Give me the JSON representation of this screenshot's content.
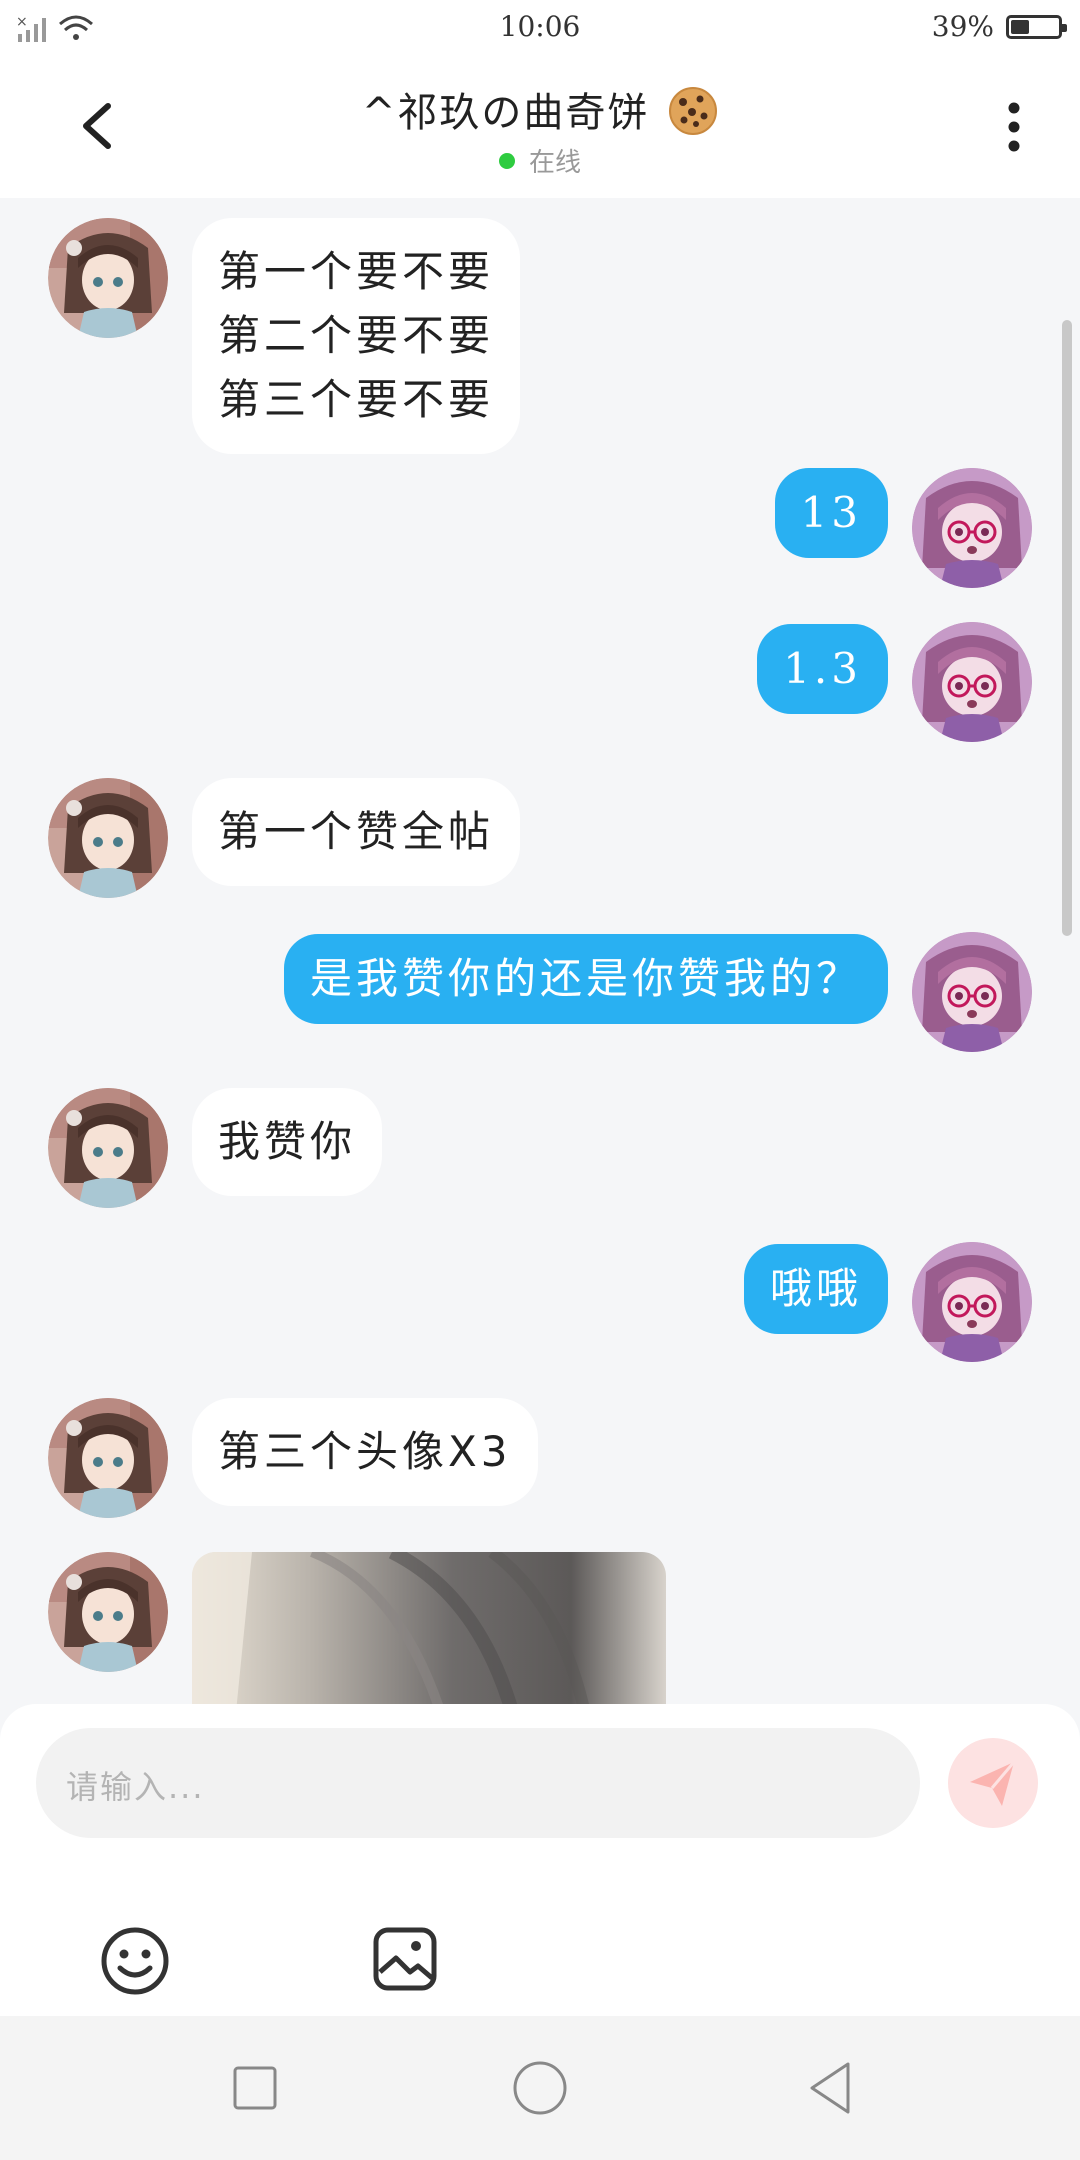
{
  "status_bar": {
    "time": "10:06",
    "battery_text": "39%",
    "battery_level": 0.39
  },
  "header": {
    "title": "^祁玖の曲奇饼",
    "status": "在线"
  },
  "messages": [
    {
      "side": "in",
      "lines": [
        "第一个要不要",
        "第二个要不要",
        "第三个要不要"
      ]
    },
    {
      "side": "out",
      "text": "13"
    },
    {
      "side": "out",
      "text": "1.3"
    },
    {
      "side": "in",
      "text": "第一个赞全帖"
    },
    {
      "side": "out",
      "text": "是我赞你的还是你赞我的？"
    },
    {
      "side": "in",
      "text": "我赞你"
    },
    {
      "side": "out",
      "text": "哦哦"
    },
    {
      "side": "in",
      "text": "第三个头像X3"
    },
    {
      "side": "in",
      "type": "image"
    }
  ],
  "input": {
    "placeholder": "请输入..."
  },
  "icons": {
    "back": "chevron-left-icon",
    "more": "more-vertical-icon",
    "send": "send-icon",
    "emoji": "smiley-icon",
    "image": "image-icon",
    "nav_recents": "square-icon",
    "nav_home": "circle-icon",
    "nav_back": "triangle-back-icon"
  },
  "colors": {
    "outgoing_bubble": "#29b0f2",
    "incoming_bubble": "#ffffff",
    "online": "#2ecc40",
    "send_button": "#fde2e2"
  }
}
